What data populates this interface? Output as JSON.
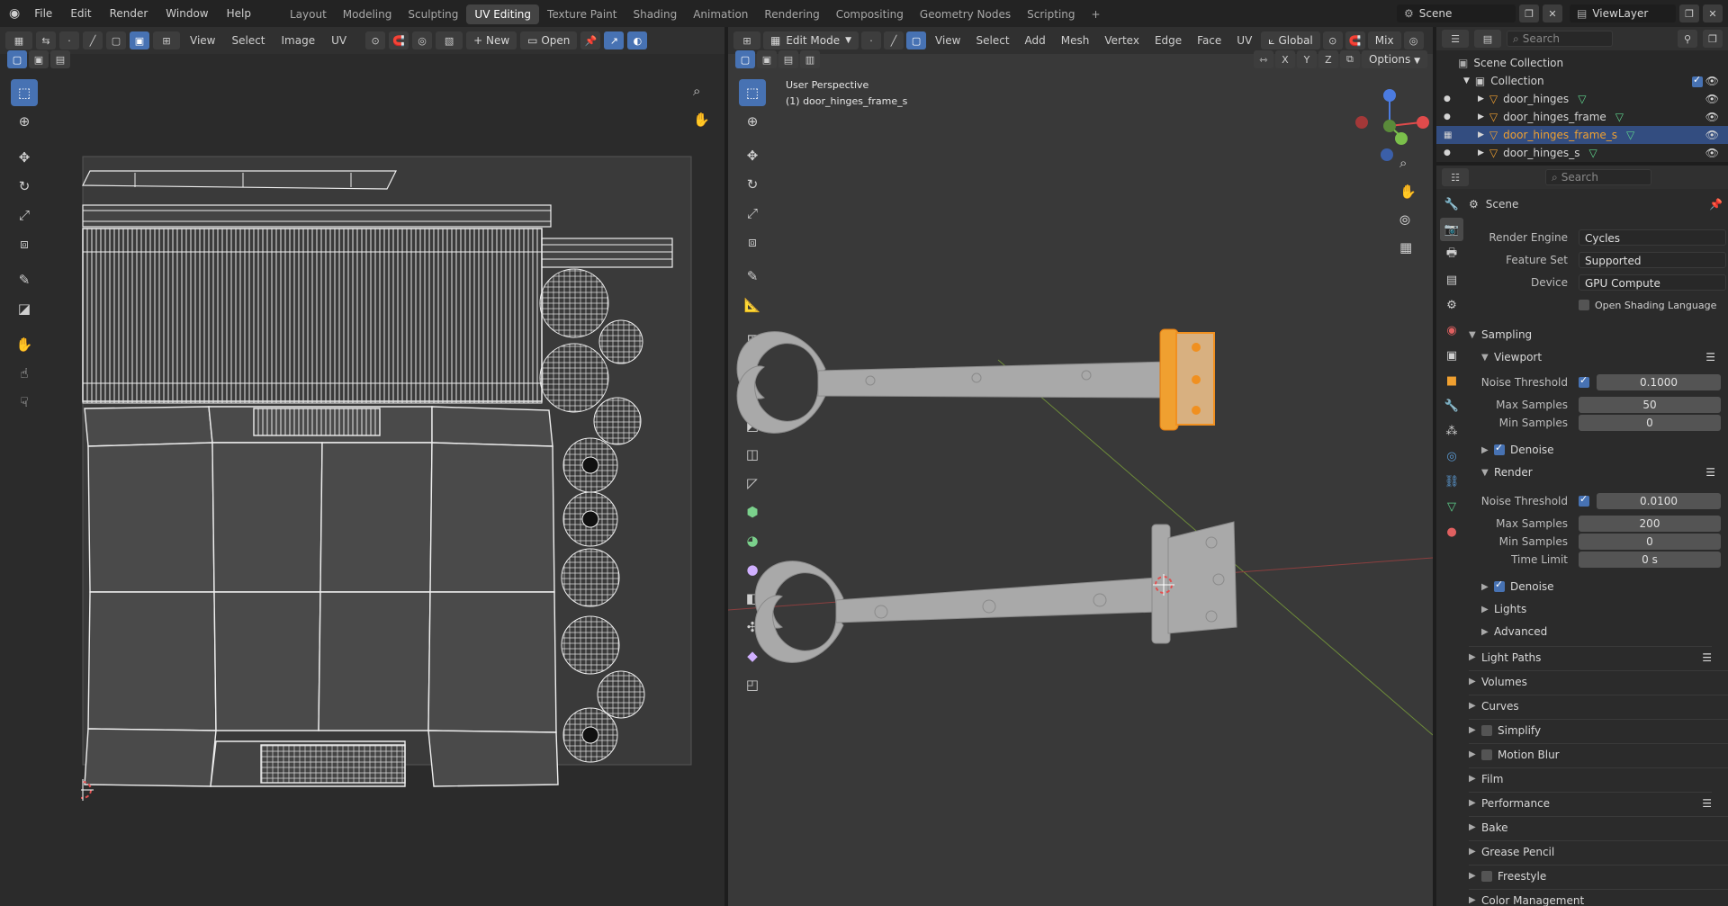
{
  "topbar": {
    "menus": [
      "File",
      "Edit",
      "Render",
      "Window",
      "Help"
    ],
    "workspaces": [
      "Layout",
      "Modeling",
      "Sculpting",
      "UV Editing",
      "Texture Paint",
      "Shading",
      "Animation",
      "Rendering",
      "Compositing",
      "Geometry Nodes",
      "Scripting"
    ],
    "active_workspace": "UV Editing",
    "add_tab": "+",
    "scene": "Scene",
    "view_layer": "ViewLayer"
  },
  "uv_editor": {
    "menus": [
      "View",
      "Select",
      "Image",
      "UV"
    ],
    "new_label": "New",
    "open_label": "Open"
  },
  "viewport": {
    "mode": "Edit Mode",
    "menus": [
      "View",
      "Select",
      "Add",
      "Mesh",
      "Vertex",
      "Edge",
      "Face",
      "UV"
    ],
    "orientation": "Global",
    "shading": "Mix",
    "options_label": "Options",
    "axes": [
      "X",
      "Y",
      "Z"
    ],
    "overlay_title": "User Perspective",
    "overlay_object": "(1) door_hinges_frame_s"
  },
  "outliner": {
    "search_placeholder": "Search",
    "scene_collection": "Scene Collection",
    "collection": "Collection",
    "items": [
      {
        "name": "door_hinges",
        "selected": false
      },
      {
        "name": "door_hinges_frame",
        "selected": false
      },
      {
        "name": "door_hinges_frame_s",
        "selected": true
      },
      {
        "name": "door_hinges_s",
        "selected": false
      }
    ]
  },
  "properties": {
    "search_placeholder": "Search",
    "context": "Scene",
    "render_engine_label": "Render Engine",
    "render_engine": "Cycles",
    "feature_set_label": "Feature Set",
    "feature_set": "Supported",
    "device_label": "Device",
    "device": "GPU Compute",
    "osl_label": "Open Shading Language",
    "sampling": "Sampling",
    "viewport_label": "Viewport",
    "noise_threshold_label": "Noise Threshold",
    "viewport_noise_threshold": "0.1000",
    "max_samples_label": "Max Samples",
    "viewport_max_samples": "50",
    "min_samples_label": "Min Samples",
    "viewport_min_samples": "0",
    "denoise_label": "Denoise",
    "render_label": "Render",
    "render_noise_threshold": "0.0100",
    "render_max_samples": "200",
    "render_min_samples": "0",
    "time_limit_label": "Time Limit",
    "time_limit": "0 s",
    "lights": "Lights",
    "advanced": "Advanced",
    "panels": [
      "Light Paths",
      "Volumes",
      "Curves",
      "Simplify",
      "Motion Blur",
      "Film",
      "Performance",
      "Bake",
      "Grease Pencil",
      "Freestyle",
      "Color Management"
    ]
  }
}
